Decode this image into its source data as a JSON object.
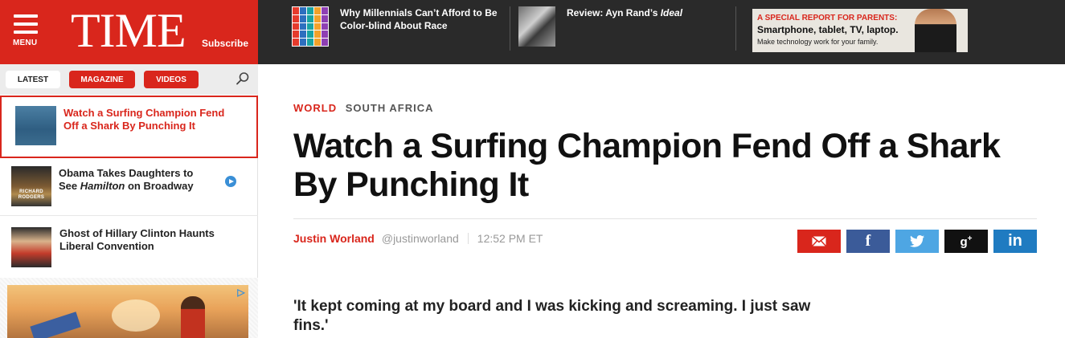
{
  "header": {
    "menu_label": "MENU",
    "logo": "TIME",
    "subscribe_label": "Subscribe",
    "brand_color": "#d9261c",
    "promos": [
      {
        "title": "Why Millennials Can’t Afford to Be Color-blind About Race",
        "thumb_icon": "colorful-mosaic-thumbnail"
      },
      {
        "title": "Review: Ayn Rand’s Ideal",
        "thumb_icon": "author-portrait-thumbnail"
      }
    ],
    "ad": {
      "line1": "A SPECIAL REPORT FOR PARENTS:",
      "line2": "Smartphone, tablet, TV, laptop.",
      "line3": "Make technology work for your family."
    }
  },
  "sidebar": {
    "tabs": [
      {
        "label": "LATEST",
        "active": true
      },
      {
        "label": "MAGAZINE",
        "active": false
      },
      {
        "label": "VIDEOS",
        "active": false
      }
    ],
    "search_icon": "search-icon",
    "stories": [
      {
        "title": "Watch a Surfing Champion Fend Off a Shark By Punching It",
        "active": true
      },
      {
        "title": "Obama Takes Daughters to See Hamilton on Broadway",
        "has_video": true,
        "thumb_caption": "RICHARD RODGERS"
      },
      {
        "title": "Ghost of Hillary Clinton Haunts Liberal Convention",
        "active": false
      }
    ]
  },
  "article": {
    "section": "WORLD",
    "subsection": "SOUTH AFRICA",
    "headline": "Watch a Surfing Champion Fend Off a Shark By Punching It",
    "author": "Justin Worland",
    "handle": "@justinworland",
    "time": "12:52 PM ET",
    "share_buttons": [
      "email",
      "facebook",
      "twitter",
      "google-plus",
      "linkedin"
    ],
    "deck": "'It kept coming at my board and I was kicking and screaming. I just saw fins.'"
  }
}
